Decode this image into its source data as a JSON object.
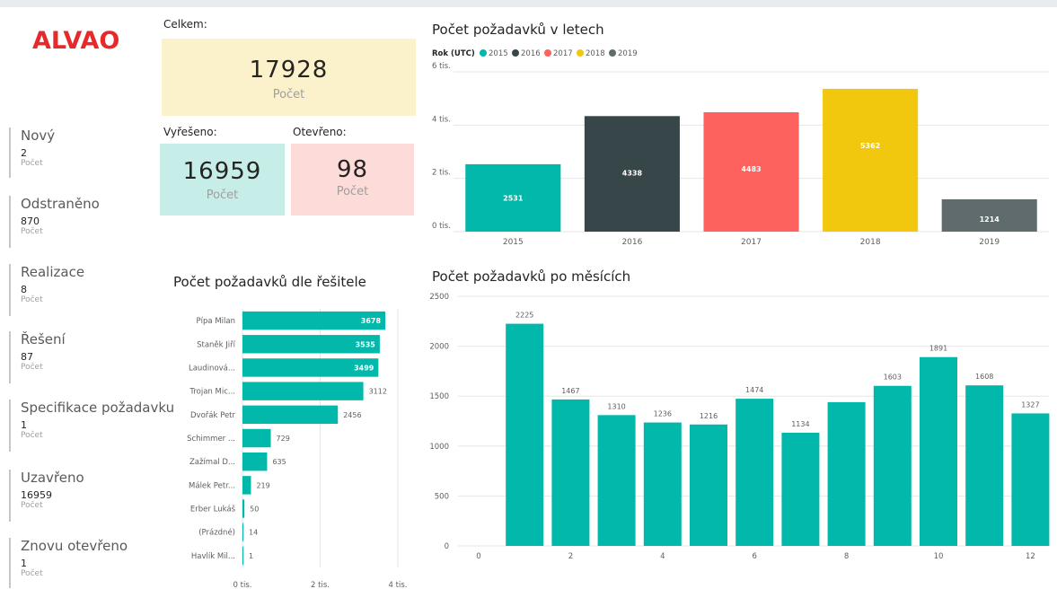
{
  "logo": {
    "text": "ALVAO"
  },
  "status_cards": [
    {
      "title": "Nový",
      "value": "2",
      "sub": "Počet"
    },
    {
      "title": "Odstraněno",
      "value": "870",
      "sub": "Počet"
    },
    {
      "title": "Realizace",
      "value": "8",
      "sub": "Počet"
    },
    {
      "title": "Řešení",
      "value": "87",
      "sub": "Počet"
    },
    {
      "title": "Specifikace požadavku",
      "value": "1",
      "sub": "Počet"
    },
    {
      "title": "Uzavřeno",
      "value": "16959",
      "sub": "Počet"
    },
    {
      "title": "Znovu otevřeno",
      "value": "1",
      "sub": "Počet"
    }
  ],
  "kpis": {
    "total": {
      "label": "Celkem:",
      "value": "17928",
      "caption": "Počet",
      "color": "#fbf1cb"
    },
    "resolved": {
      "label": "Vyřešeno:",
      "value": "16959",
      "caption": "Počet",
      "color": "#c7ede9"
    },
    "open": {
      "label": "Otevřeno:",
      "value": "98",
      "caption": "Počet",
      "color": "#fcdbd8"
    }
  },
  "chart_data": [
    {
      "type": "bar",
      "title": "Počet požadavků v letech",
      "legend_title": "Rok (UTC)",
      "legend_position": "top-left",
      "categories": [
        "2015",
        "2016",
        "2017",
        "2018",
        "2019"
      ],
      "values": [
        2531,
        4338,
        4483,
        5362,
        1214
      ],
      "data_labels": [
        "2531",
        "4338",
        "4483",
        "5362",
        "1214"
      ],
      "colors": [
        "#01b8aa",
        "#374649",
        "#fd625e",
        "#f2c80f",
        "#5f6b6d"
      ],
      "y_ticks": [
        "0 tis.",
        "2 tis.",
        "4 tis.",
        "6 tis."
      ],
      "ylim": [
        0,
        6000
      ],
      "grid": true
    },
    {
      "type": "bar",
      "orientation": "horizontal",
      "title": "Počet požadavků dle řešitele",
      "categories": [
        "Pípa Milan",
        "Staněk Jiří",
        "Laudinová...",
        "Trojan Mic...",
        "Dvořák Petr",
        "Schimmer ...",
        "Zažímal D...",
        "Málek Petr...",
        "Erber Lukáš",
        "(Prázdné)",
        "Havlík Mil..."
      ],
      "values": [
        3678,
        3535,
        3499,
        3112,
        2456,
        729,
        635,
        219,
        50,
        14,
        1
      ],
      "data_labels": [
        "3678",
        "3535",
        "3499",
        "3112",
        "2456",
        "729",
        "635",
        "219",
        "50",
        "14",
        "1"
      ],
      "color": "#01b8aa",
      "x_ticks": [
        "0 tis.",
        "2 tis.",
        "4 tis."
      ],
      "xlim": [
        0,
        4000
      ],
      "grid": true
    },
    {
      "type": "bar",
      "title": "Počet požadavků po měsících",
      "x": [
        1,
        2,
        3,
        4,
        5,
        6,
        7,
        8,
        9,
        10,
        11,
        12
      ],
      "values": [
        2225,
        1467,
        1310,
        1236,
        1216,
        1474,
        1134,
        1440,
        1603,
        1891,
        1608,
        1327
      ],
      "data_labels": [
        "2225",
        "1467",
        "1310",
        "1236",
        "1216",
        "1474",
        "1134",
        "",
        "1603",
        "1891",
        "1608",
        "1327"
      ],
      "color": "#01b8aa",
      "x_ticks": [
        "0",
        "2",
        "4",
        "6",
        "8",
        "10",
        "12"
      ],
      "y_ticks": [
        "0",
        "500",
        "1000",
        "1500",
        "2000",
        "2500"
      ],
      "xlim": [
        0,
        12
      ],
      "ylim": [
        0,
        2500
      ],
      "grid": true
    }
  ]
}
